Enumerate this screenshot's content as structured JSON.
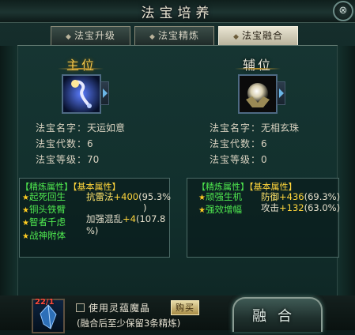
{
  "window": {
    "title": "法宝培养",
    "close_glyph": "⊗"
  },
  "tabs": [
    {
      "label": "法宝升级",
      "active": false
    },
    {
      "label": "法宝精炼",
      "active": false
    },
    {
      "label": "法宝融合",
      "active": true
    }
  ],
  "main_slot": {
    "heading": "主位",
    "name_label": "法宝名字：",
    "name_value": "天运如意",
    "generation_label": "法宝代数：",
    "generation_value": "6",
    "level_label": "法宝等级：",
    "level_value": "70",
    "refine_header": "【精炼属性】",
    "base_header": "【基本属性】",
    "refine_attrs": [
      "起死回生",
      "铜头铁臂",
      "智者千虑",
      "战神附体"
    ],
    "base_attrs": [
      {
        "name": "抗雷法",
        "value": "+400",
        "pct": "(95.3%"
      },
      {
        "name": "",
        "value": "",
        "pct": ")"
      },
      {
        "name": "加强混乱",
        "value": "+4",
        "pct": "(107.8"
      },
      {
        "name": "",
        "value": "",
        "pct": "%)"
      }
    ]
  },
  "aux_slot": {
    "heading": "辅位",
    "name_label": "法宝名字：",
    "name_value": "无相玄珠",
    "generation_label": "法宝代数：",
    "generation_value": "6",
    "level_label": "法宝等级：",
    "level_value": "0",
    "refine_header": "【精炼属性】",
    "base_header": "【基本属性】",
    "refine_attrs": [
      "顽强生机",
      "强效增幅"
    ],
    "base_attrs": [
      {
        "name": "防御",
        "value": "+436",
        "pct": "(69.3%)"
      },
      {
        "name": "攻击",
        "value": "+132",
        "pct": "(63.0%)"
      }
    ]
  },
  "bottom": {
    "item_count": "22/1",
    "use_label": "使用灵蕴魔晶",
    "use_checked": false,
    "buy_label": "购买",
    "hint": "(融合后至少保留3条精炼)",
    "fuse_label": "融合"
  },
  "colors": {
    "green": "#4fe84f",
    "yellow": "#ffd53b",
    "gold": "#f5c74a"
  }
}
